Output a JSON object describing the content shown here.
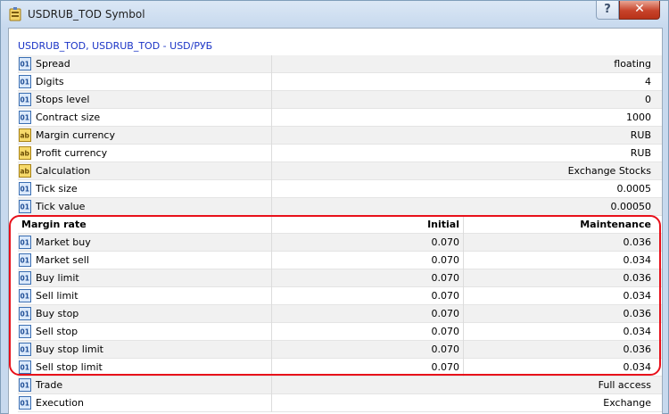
{
  "window": {
    "title": "USDRUB_TOD Symbol",
    "help_label": "?",
    "close_label": "✕"
  },
  "symbol_header": "USDRUB_TOD, USDRUB_TOD - USD/РУБ",
  "properties": [
    {
      "icon": "numeric",
      "name": "Spread",
      "value": "floating"
    },
    {
      "icon": "numeric",
      "name": "Digits",
      "value": "4"
    },
    {
      "icon": "numeric",
      "name": "Stops level",
      "value": "0"
    },
    {
      "icon": "numeric",
      "name": "Contract size",
      "value": "1000"
    },
    {
      "icon": "text",
      "name": "Margin currency",
      "value": "RUB"
    },
    {
      "icon": "text",
      "name": "Profit currency",
      "value": "RUB"
    },
    {
      "icon": "text",
      "name": "Calculation",
      "value": "Exchange Stocks"
    },
    {
      "icon": "numeric",
      "name": "Tick size",
      "value": "0.0005"
    },
    {
      "icon": "numeric",
      "name": "Tick value",
      "value": "0.00050"
    }
  ],
  "margin": {
    "header": {
      "name": "Margin rate",
      "initial": "Initial",
      "maintenance": "Maintenance"
    },
    "rows": [
      {
        "name": "Market buy",
        "initial": "0.070",
        "maintenance": "0.036"
      },
      {
        "name": "Market sell",
        "initial": "0.070",
        "maintenance": "0.034"
      },
      {
        "name": "Buy limit",
        "initial": "0.070",
        "maintenance": "0.036"
      },
      {
        "name": "Sell limit",
        "initial": "0.070",
        "maintenance": "0.034"
      },
      {
        "name": "Buy stop",
        "initial": "0.070",
        "maintenance": "0.036"
      },
      {
        "name": "Sell stop",
        "initial": "0.070",
        "maintenance": "0.034"
      },
      {
        "name": "Buy stop limit",
        "initial": "0.070",
        "maintenance": "0.036"
      },
      {
        "name": "Sell stop limit",
        "initial": "0.070",
        "maintenance": "0.034"
      }
    ]
  },
  "trailing": [
    {
      "icon": "numeric",
      "name": "Trade",
      "value": "Full access"
    },
    {
      "icon": "numeric",
      "name": "Execution",
      "value": "Exchange"
    }
  ],
  "icon_text": {
    "numeric": "01",
    "text": "ab"
  },
  "colors": {
    "highlight": "#e8101a",
    "link": "#1b34c6"
  }
}
